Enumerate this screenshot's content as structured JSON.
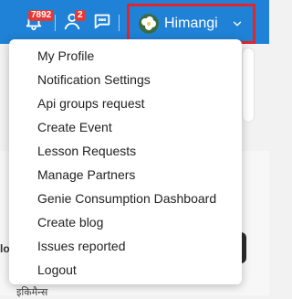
{
  "topbar": {
    "notifications": {
      "icon": "bell-icon",
      "badge": "7892"
    },
    "friends": {
      "icon": "user-icon",
      "badge": "2"
    },
    "chat": {
      "icon": "chat-icon"
    },
    "user": {
      "name": "Himangi",
      "avatar": "flower-avatar",
      "dropdown_icon": "chevron-down-icon"
    }
  },
  "dropdown": {
    "items": [
      "My Profile",
      "Notification Settings",
      "Api groups request",
      "Create Event",
      "Lesson Requests",
      "Manage Partners",
      "Genie Consumption Dashboard",
      "Create blog",
      "Issues reported",
      "Logout"
    ]
  },
  "background": {
    "left_text": "lo",
    "bottom_text": "इकिमैन्स"
  },
  "colors": {
    "topbar": "#1f82d6",
    "highlight_border": "#e1252a",
    "badge": "#e53935"
  }
}
